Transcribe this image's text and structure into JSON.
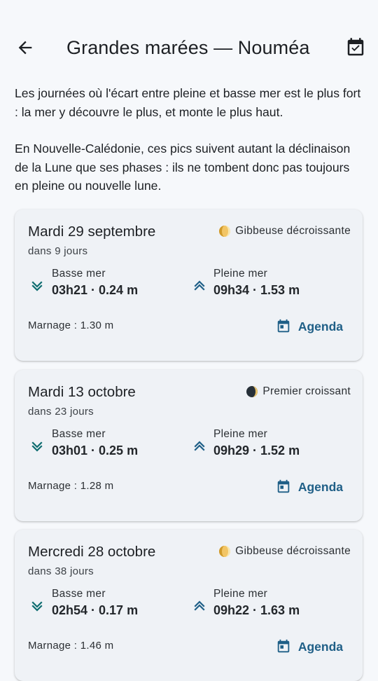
{
  "header": {
    "title": "Grandes marées — Nouméa",
    "back_icon": "arrow-back-icon",
    "calendar_icon": "event-available-icon"
  },
  "intro": {
    "paragraph1": "Les journées où l'écart entre pleine et basse mer est le plus fort : la mer y découvre le plus, et monte le plus haut.",
    "paragraph2": "En Nouvelle-Calédonie, ces pics suivent autant la déclinaison de la Lune que ses phases : ils ne tombent donc pas toujours en pleine ou nouvelle lune."
  },
  "colors": {
    "accent": "#1f5f87",
    "tide_icon": "#0f6d70",
    "card_bg": "#eff2f6",
    "page_bg": "#f6f8fb"
  },
  "cards": [
    {
      "date": "Mardi 29 septembre",
      "days": "dans 9 jours",
      "moon_phase": "Gibbeuse décroissante",
      "moon_icon": "waning-gibbous-moon-icon",
      "low_label": "Basse mer",
      "low_value": "03h21 · 0.24 m",
      "high_label": "Pleine mer",
      "high_value": "09h34 · 1.53 m",
      "range": "Marnage : 1.30 m",
      "agenda_label": "Agenda"
    },
    {
      "date": "Mardi 13 octobre",
      "days": "dans 23 jours",
      "moon_phase": "Premier croissant",
      "moon_icon": "waxing-crescent-moon-icon",
      "low_label": "Basse mer",
      "low_value": "03h01 · 0.25 m",
      "high_label": "Pleine mer",
      "high_value": "09h29 · 1.52 m",
      "range": "Marnage : 1.28 m",
      "agenda_label": "Agenda"
    },
    {
      "date": "Mercredi 28 octobre",
      "days": "dans 38 jours",
      "moon_phase": "Gibbeuse décroissante",
      "moon_icon": "waning-gibbous-moon-icon",
      "low_label": "Basse mer",
      "low_value": "02h54 · 0.17 m",
      "high_label": "Pleine mer",
      "high_value": "09h22 · 1.63 m",
      "range": "Marnage : 1.46 m",
      "agenda_label": "Agenda"
    }
  ]
}
